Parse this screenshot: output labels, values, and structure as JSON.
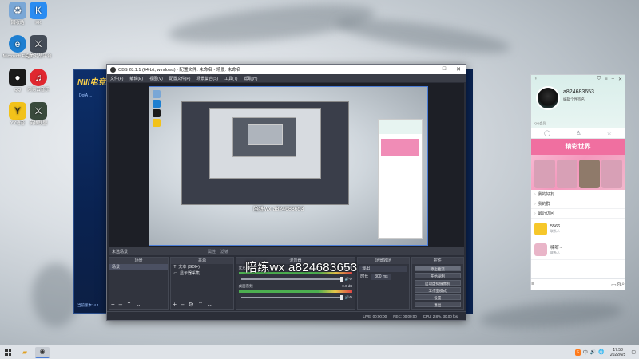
{
  "desktop": {
    "icons": [
      {
        "label": "回收站",
        "icon": "recycle-bin-icon",
        "color": "#7aa7d6",
        "glyph": "♻"
      },
      {
        "label": "KK",
        "icon": "kk-icon",
        "color": "#2a8cf2",
        "glyph": "K"
      },
      {
        "label": "Microsoft Edge",
        "icon": "edge-icon",
        "color": "#1e7fd1",
        "glyph": "e"
      },
      {
        "label": "完美对战平台",
        "icon": "game-platform-icon",
        "color": "#444c57",
        "glyph": "⚔"
      },
      {
        "label": "QQ",
        "icon": "qq-icon",
        "color": "#1a1a1a",
        "glyph": "🐧"
      },
      {
        "label": "网易云音乐",
        "icon": "netease-music-icon",
        "color": "#e0272f",
        "glyph": "♫"
      },
      {
        "label": "YY语音",
        "icon": "yy-icon",
        "color": "#f2c21a",
        "glyph": "Y"
      },
      {
        "label": "英雄联盟",
        "icon": "lol-icon",
        "color": "#394a3c",
        "glyph": "⚔"
      }
    ]
  },
  "bg_app": {
    "logo": "NIII电竞",
    "dota": "DotA ...",
    "version": "当前版本: 4.1"
  },
  "obs": {
    "title": "OBS 28.1.1 (64-bit, windows) - 配置文件: 未命名 - 场景: 未命名",
    "menu": [
      "文件(F)",
      "编辑(E)",
      "视图(V)",
      "配置文件(P)",
      "场景集合(S)",
      "工具(T)",
      "帮助(H)"
    ],
    "watermark_small": "陪练wx a824683653",
    "watermark_big": "陪练wx a824683653",
    "scene_bar": "未选场景",
    "scene_bar_tabs": [
      "属性",
      "滤镜"
    ],
    "panels": {
      "scenes": {
        "title": "场景",
        "items": [
          "场景"
        ]
      },
      "sources": {
        "title": "来源",
        "items": [
          "文本 (GDI+)",
          "显示器采集"
        ]
      },
      "mixer": {
        "title": "混音器",
        "tracks": [
          {
            "name": "麦克风/Aux",
            "db": "0.0 dB"
          },
          {
            "name": "桌面音频",
            "db": "0.0 dB"
          }
        ]
      },
      "transitions": {
        "title": "场景转场",
        "mode": "淡出",
        "duration_label": "时长",
        "duration": "300 ms"
      },
      "controls": {
        "title": "控件",
        "buttons": [
          "停止推流",
          "开始录制",
          "启动虚拟摄像机",
          "工作室模式",
          "设置",
          "退出"
        ]
      }
    },
    "status": [
      "LIVE: 00:00:00",
      "REC: 00:00:00",
      "CPU: 2.8%, 30.00 fps"
    ]
  },
  "qq": {
    "title_icon": "pin-icon",
    "name": "a824683653",
    "signature": "编辑个性签名",
    "note": "QQ会员",
    "banner_title": "精彩世界",
    "list": [
      "我的好友",
      "我的群",
      "最近访问"
    ],
    "contacts": [
      {
        "name": "5566",
        "sub": "联系人",
        "color": "#f6c72a"
      },
      {
        "name": "嗨呀~",
        "sub": "联系人",
        "color": "#e9b5c8"
      }
    ],
    "accent": "#f06fa0"
  },
  "taskbar": {
    "apps": [
      "文件夹",
      "OBS"
    ],
    "tray": [
      "中",
      "🔊",
      "🌐"
    ],
    "time": "17:58",
    "date": "2022/6/5"
  }
}
